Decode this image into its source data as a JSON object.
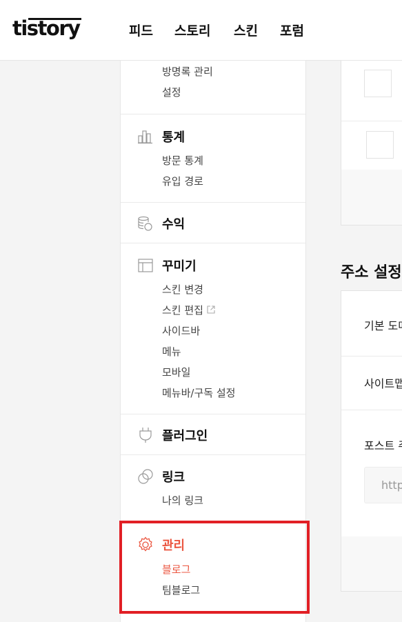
{
  "header": {
    "logo": "tistory",
    "nav": [
      "피드",
      "스토리",
      "스킨",
      "포럼"
    ]
  },
  "sidebar": {
    "top_items": [
      "방명록 관리",
      "설정"
    ],
    "stats": {
      "title": "통계",
      "items": [
        "방문 통계",
        "유입 경로"
      ]
    },
    "revenue": {
      "title": "수익"
    },
    "decorate": {
      "title": "꾸미기",
      "items": [
        "스킨 변경",
        "스킨 편집",
        "사이드바",
        "메뉴",
        "모바일",
        "메뉴바/구독 설정"
      ]
    },
    "plugin": {
      "title": "플러그인"
    },
    "link": {
      "title": "링크",
      "items": [
        "나의 링크"
      ]
    },
    "manage": {
      "title": "관리",
      "items": [
        "블로그",
        "팀블로그"
      ]
    }
  },
  "main": {
    "address_title": "주소 설정",
    "rows": [
      "기본 도메인",
      "사이트맵",
      "포스트 주소"
    ],
    "input_placeholder": "https://"
  },
  "colors": {
    "accent": "#eb5640",
    "highlight_border": "#e11f25"
  }
}
